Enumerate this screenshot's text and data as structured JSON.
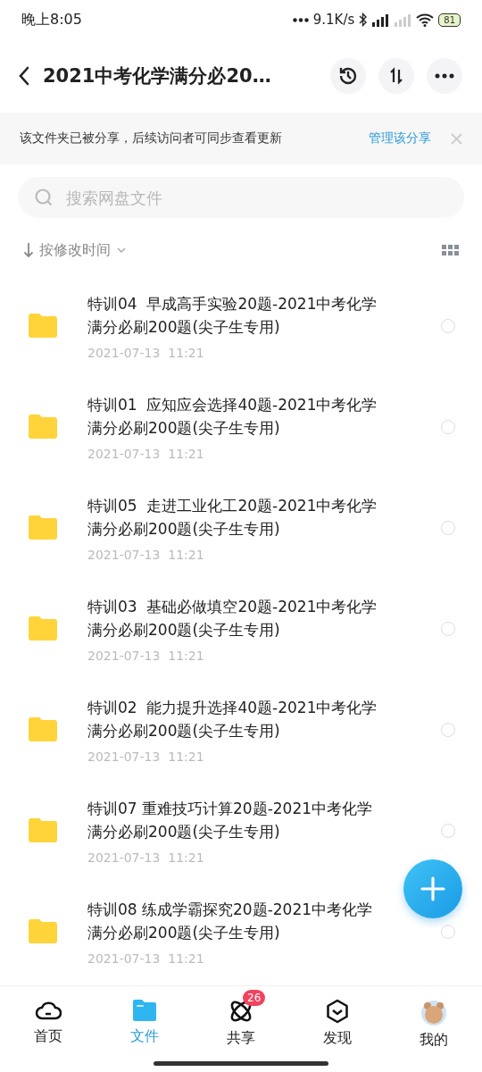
{
  "status_bar": {
    "time": "晚上8:05",
    "speed": "9.1K/s",
    "battery": "81"
  },
  "header": {
    "title": "2021中考化学满分必20…"
  },
  "banner": {
    "text": "该文件夹已被分享，后续访问者可同步查看更新",
    "link": "管理该分享"
  },
  "search": {
    "placeholder": "搜索网盘文件"
  },
  "sort": {
    "label": "按修改时间"
  },
  "files": [
    {
      "title": "特训04  早成高手实验20题-2021中考化学满分必刷200题(尖子生专用)",
      "date": "2021-07-13  11:21",
      "selected": false
    },
    {
      "title": "特训01  应知应会选择40题-2021中考化学满分必刷200题(尖子生专用)",
      "date": "2021-07-13  11:21",
      "selected": false
    },
    {
      "title": "特训05  走进工业化工20题-2021中考化学满分必刷200题(尖子生专用)",
      "date": "2021-07-13  11:21",
      "selected": false
    },
    {
      "title": "特训03  基础必做填空20题-2021中考化学满分必刷200题(尖子生专用)",
      "date": "2021-07-13  11:21",
      "selected": false
    },
    {
      "title": "特训02  能力提升选择40题-2021中考化学满分必刷200题(尖子生专用)",
      "date": "2021-07-13  11:21",
      "selected": false
    },
    {
      "title": "特训07 重难技巧计算20题-2021中考化学满分必刷200题(尖子生专用)",
      "date": "2021-07-13  11:21",
      "selected": false
    },
    {
      "title": "特训08 练成学霸探究20题-2021中考化学满分必刷200题(尖子生专用)",
      "date": "2021-07-13  11:21",
      "selected": false
    }
  ],
  "nav": [
    {
      "kind": "home",
      "label": "首页",
      "selected": false
    },
    {
      "kind": "files",
      "label": "文件",
      "selected": true
    },
    {
      "kind": "share",
      "label": "共享",
      "selected": false,
      "badge": "26"
    },
    {
      "kind": "discover",
      "label": "发现",
      "selected": false
    },
    {
      "kind": "profile",
      "label": "我的",
      "selected": false
    }
  ]
}
